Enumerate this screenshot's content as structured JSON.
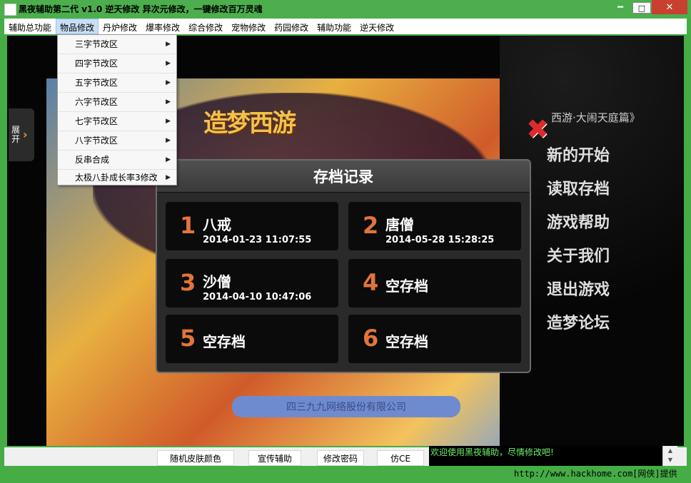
{
  "window": {
    "title": "黑夜辅助第二代 v1.0  逆天修改 异次元修改，一键修改百万灵魂"
  },
  "menubar": [
    "辅助总功能",
    "物品修改",
    "丹炉修改",
    "爆率修改",
    "综合修改",
    "宠物修改",
    "药园修改",
    "辅助功能",
    "逆天修改"
  ],
  "dropdown": [
    "三字节改区",
    "四字节改区",
    "五字节改区",
    "六字节改区",
    "七字节改区",
    "八字节改区",
    "反串合成",
    "太极八卦成长率3修改"
  ],
  "expand_tab": {
    "label": "展开",
    "arrow": "›"
  },
  "game": {
    "logo": "造梦西游",
    "subtitle": "西游·大闹天庭篇》",
    "side_menu": [
      "新的开始",
      "读取存档",
      "游戏帮助",
      "关于我们",
      "退出游戏",
      "造梦论坛"
    ],
    "company": "四三九九网络股份有限公司",
    "dialog_title": "存档记录",
    "slots": [
      {
        "num": "1",
        "name": "八戒",
        "time": "2014-01-23 11:07:55"
      },
      {
        "num": "2",
        "name": "唐僧",
        "time": "2014-05-28 15:28:25"
      },
      {
        "num": "3",
        "name": "沙僧",
        "time": "2014-04-10 10:47:06"
      },
      {
        "num": "4",
        "name": "空存档",
        "time": ""
      },
      {
        "num": "5",
        "name": "空存档",
        "time": ""
      },
      {
        "num": "6",
        "name": "空存档",
        "time": ""
      }
    ]
  },
  "bottom_buttons": [
    "随机皮肤颜色",
    "宣传辅助",
    "修改密码",
    "仿CE"
  ],
  "log": "欢迎使用黑夜辅助，尽情修改吧!",
  "watermark": "http://www.hackhome.com[网侠]提供",
  "colors": {
    "accent_green": "#4cae4c",
    "slot_number": "#e2743a",
    "log_text": "#6cf06c"
  }
}
